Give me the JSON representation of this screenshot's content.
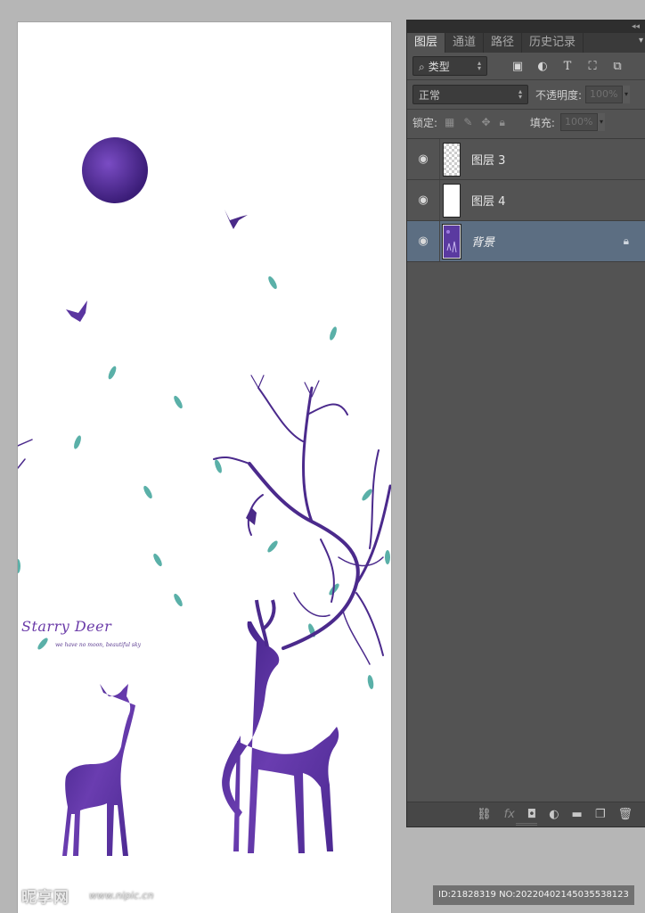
{
  "artwork": {
    "title": "Starry Deer",
    "subtitle": "we have no moon, beautiful sky",
    "colors": {
      "purple": "#5b2d9a",
      "deep_purple": "#3a1d72",
      "leaf": "#4fa8a0"
    }
  },
  "panel": {
    "collapse_glyph": "◂◂",
    "tabs": [
      {
        "label": "图层",
        "active": true
      },
      {
        "label": "通道",
        "active": false
      },
      {
        "label": "路径",
        "active": false
      },
      {
        "label": "历史记录",
        "active": false
      }
    ],
    "filter": {
      "icon": "search-icon",
      "value": "类型"
    },
    "filter_icons": [
      "image-filter-icon",
      "adjustment-filter-icon",
      "type-filter-icon",
      "shape-filter-icon",
      "smart-object-filter-icon"
    ],
    "blend_mode": "正常",
    "opacity_label": "不透明度:",
    "opacity_value": "100%",
    "lock_label": "锁定:",
    "fill_label": "填充:",
    "fill_value": "100%",
    "layers": [
      {
        "name": "图层 3",
        "visible": true,
        "selected": false,
        "locked": false
      },
      {
        "name": "图层 4",
        "visible": true,
        "selected": false,
        "locked": false
      },
      {
        "name": "背景",
        "visible": true,
        "selected": true,
        "locked": true
      }
    ],
    "bottom_icons": [
      "link-icon",
      "fx-icon",
      "mask-icon",
      "adjustment-icon",
      "folder-icon",
      "new-layer-icon",
      "trash-icon"
    ],
    "bottom_fx_label": "fx"
  },
  "watermark": {
    "logo": "昵享网",
    "url": "www.nipic.cn",
    "id_text": "ID:21828319 NO:20220402145035538123"
  }
}
